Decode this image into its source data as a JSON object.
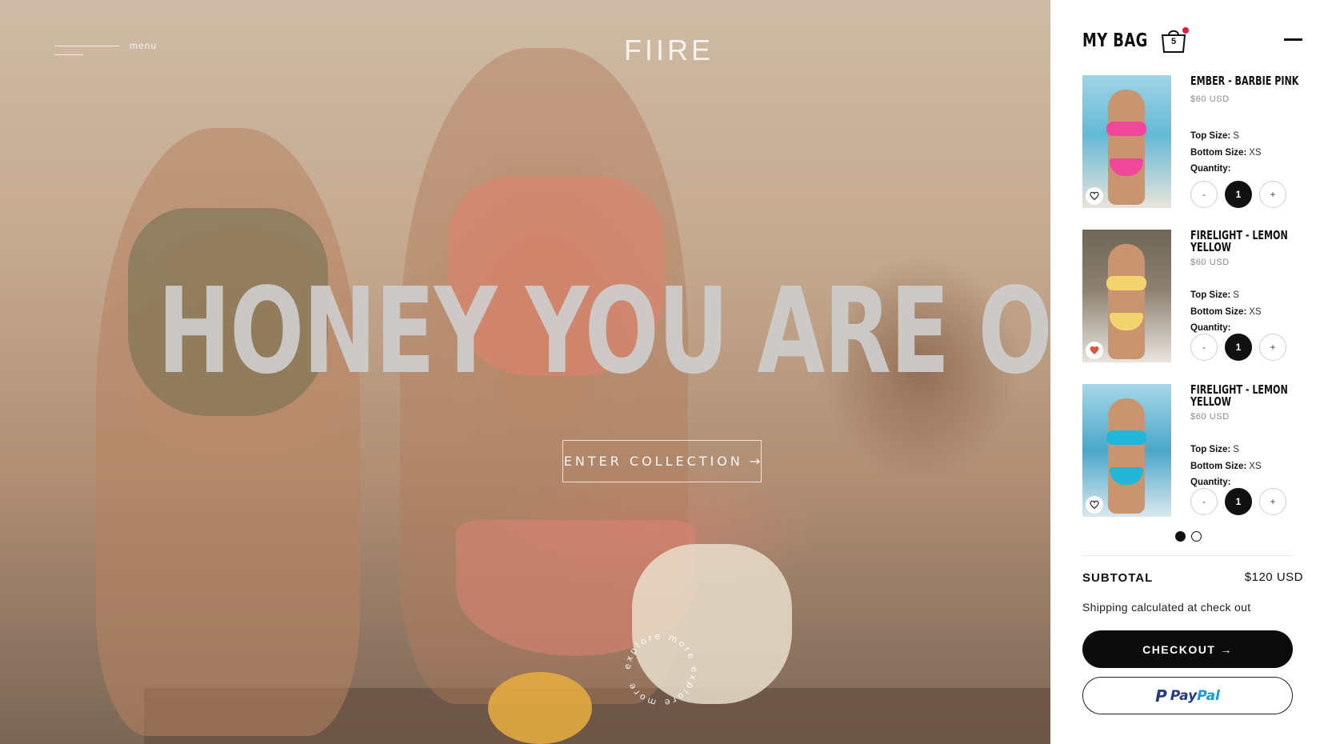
{
  "hero": {
    "menu_label": "menu",
    "brand": "FIIRE",
    "headline": "HONEY YOU ARE ON FIRE",
    "cta_label": "ENTER COLLECTION",
    "cta_arrow": "→",
    "explore_text": "explore more explore more"
  },
  "bag": {
    "title": "MY BAG",
    "count": "5",
    "items": [
      {
        "name": "EMBER - BARBIE PINK",
        "price": "$60 USD",
        "top_label": "Top Size:",
        "top_size": "S",
        "bottom_label": "Bottom Size:",
        "bottom_size": "XS",
        "qty_label": "Quantity:",
        "qty": "1",
        "minus": "-",
        "plus": "+",
        "favorite": false
      },
      {
        "name": "FIRELIGHT - LEMON YELLOW",
        "price": "$60 USD",
        "top_label": "Top Size:",
        "top_size": "S",
        "bottom_label": "Bottom Size:",
        "bottom_size": "XS",
        "qty_label": "Quantity:",
        "qty": "1",
        "minus": "-",
        "plus": "+",
        "favorite": true
      },
      {
        "name": "FIRELIGHT - LEMON YELLOW",
        "price": "$60 USD",
        "top_label": "Top Size:",
        "top_size": "S",
        "bottom_label": "Bottom Size:",
        "bottom_size": "XS",
        "qty_label": "Quantity:",
        "qty": "1",
        "minus": "-",
        "plus": "+",
        "favorite": false
      }
    ],
    "subtotal_label": "SUBTOTAL",
    "subtotal_value": "$120 USD",
    "shipping_note": "Shipping calculated at check out",
    "checkout_label": "CHECKOUT",
    "checkout_arrow": "→",
    "paypal_pay": "Pay",
    "paypal_pal": "Pal"
  },
  "colors": {
    "accent_dark": "#0c0c0c",
    "badge_dot": "#e11d3a",
    "favorite_heart": "#e0533b",
    "paypal_dark": "#253b80",
    "paypal_light": "#179bd7"
  }
}
